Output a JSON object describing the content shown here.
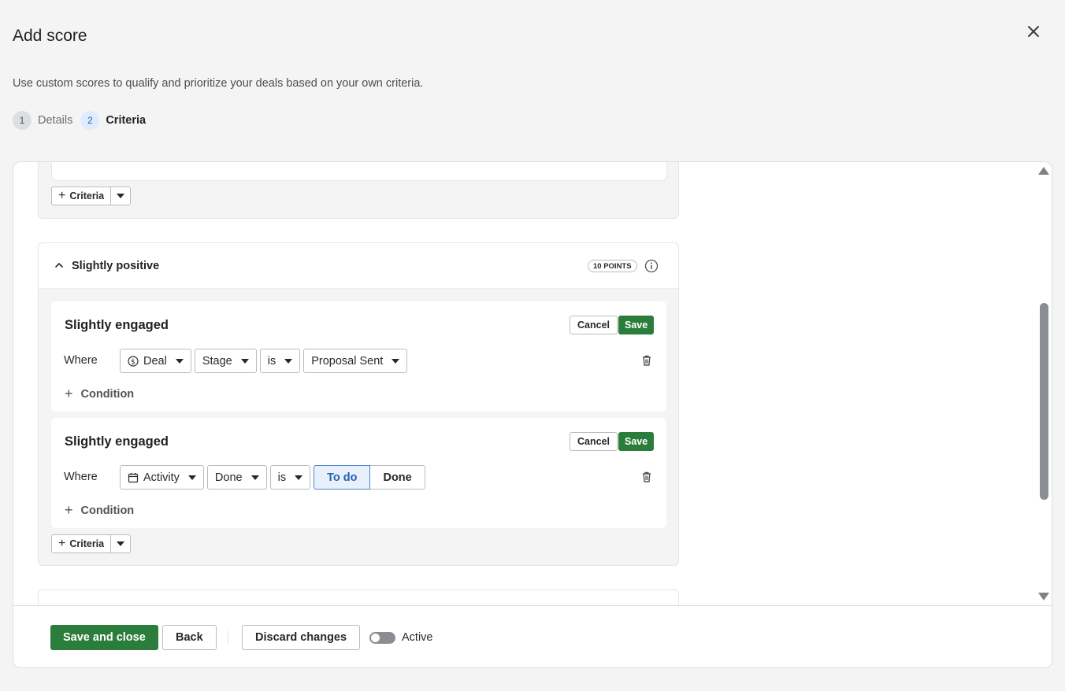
{
  "header": {
    "title": "Add score",
    "subtitle": "Use custom scores to qualify and prioritize your deals based on your own criteria."
  },
  "steps": [
    {
      "num": "1",
      "label": "Details",
      "state": "done"
    },
    {
      "num": "2",
      "label": "Criteria",
      "state": "active"
    }
  ],
  "criteria_button": {
    "label": "Criteria"
  },
  "group": {
    "title": "Slightly positive",
    "points": "10 POINTS"
  },
  "rules": [
    {
      "title": "Slightly engaged",
      "cancel": "Cancel",
      "save": "Save",
      "where": "Where",
      "entity": "Deal",
      "entity_icon": "dollar-circle-icon",
      "field": "Stage",
      "operator": "is",
      "value": "Proposal Sent",
      "condition": "Condition"
    },
    {
      "title": "Slightly engaged",
      "cancel": "Cancel",
      "save": "Save",
      "where": "Where",
      "entity": "Activity",
      "entity_icon": "calendar-icon",
      "field": "Done",
      "operator": "is",
      "options": [
        "To do",
        "Done"
      ],
      "selected": "To do",
      "condition": "Condition"
    }
  ],
  "footer": {
    "save_close": "Save and close",
    "back": "Back",
    "discard": "Discard changes",
    "toggle_label": "Active",
    "toggle_on": false
  },
  "colors": {
    "primary": "#2a7d3a",
    "selected_blue": "#2164b8",
    "background": "#f4f4f4"
  }
}
